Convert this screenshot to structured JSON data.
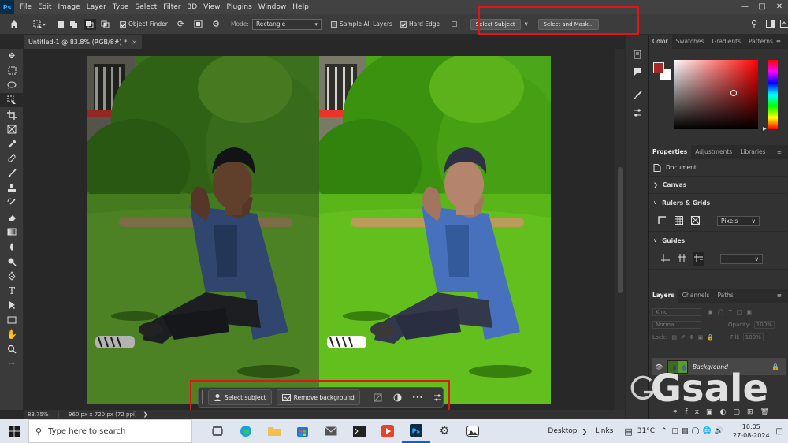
{
  "app": {
    "logo": "Ps"
  },
  "menubar": {
    "items": [
      "File",
      "Edit",
      "Image",
      "Layer",
      "Type",
      "Select",
      "Filter",
      "3D",
      "View",
      "Plugins",
      "Window",
      "Help"
    ],
    "window_controls": [
      "minimize-icon",
      "maximize-icon",
      "close-icon"
    ]
  },
  "options": {
    "object_finder": "Object Finder",
    "mode_label": "Mode:",
    "mode_value": "Rectangle",
    "sample_all_layers": "Sample All Layers",
    "hard_edge": "Hard Edge",
    "select_subject": "Select Subject",
    "select_and_mask": "Select and Mask...",
    "object_finder_checked": true,
    "sample_all_layers_checked": false,
    "hard_edge_checked": true
  },
  "document": {
    "tab_title": "Untitled-1 @ 83.8% (RGB/8#) *",
    "close": "×"
  },
  "context_bar": {
    "select_subject": "Select subject",
    "remove_background": "Remove background",
    "more": "•••"
  },
  "status": {
    "zoom": "83.75%",
    "dimensions": "960 px x 720 px (72 ppi)"
  },
  "color_panel": {
    "tabs": [
      "Color",
      "Swatches",
      "Gradients",
      "Patterns"
    ],
    "foreground": "#a52a2a",
    "background": "#ffffff"
  },
  "properties_panel": {
    "tabs": [
      "Properties",
      "Adjustments",
      "Libraries"
    ],
    "document_label": "Document",
    "canvas_label": "Canvas",
    "rulers_grids_label": "Rulers & Grids",
    "units_value": "Pixels",
    "guides_label": "Guides"
  },
  "layers_panel": {
    "tabs": [
      "Layers",
      "Channels",
      "Paths"
    ],
    "kind_placeholder": "Kind",
    "blend_mode": "Normal",
    "opacity_label": "Opacity:",
    "opacity_value": "100%",
    "lock_label": "Lock:",
    "fill_label": "Fill:",
    "fill_value": "100%",
    "layer_name": "Background"
  },
  "watermark": {
    "text": "Gsale"
  },
  "taskbar": {
    "search_placeholder": "Type here to search",
    "desktop_label": "Desktop",
    "links_label": "Links",
    "weather": "31°C",
    "time": "10:05",
    "date": "27-08-2024"
  }
}
